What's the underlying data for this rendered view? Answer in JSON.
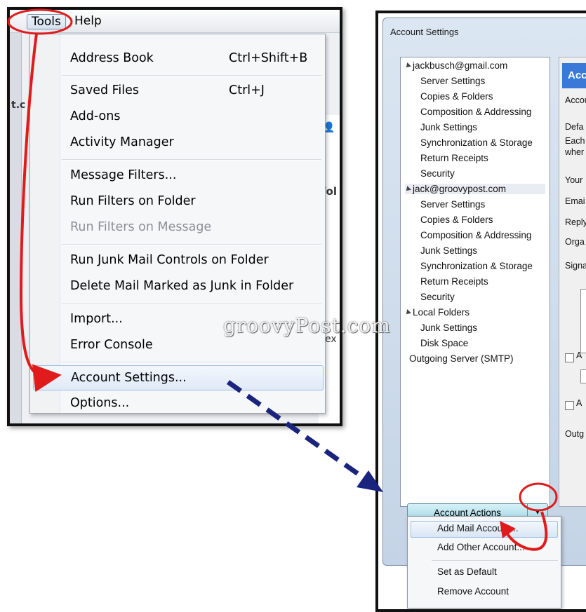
{
  "left": {
    "menubar": {
      "tools": "Tools",
      "help": "Help"
    },
    "background": {
      "folder_fragment": "fol",
      "ex_fragment": "ex",
      "c_fragment": "t.c"
    },
    "menu": [
      {
        "label": "Address Book",
        "shortcut": "Ctrl+Shift+B"
      },
      {
        "label": "Saved Files",
        "shortcut": "Ctrl+J"
      },
      {
        "label": "Add-ons"
      },
      {
        "label": "Activity Manager"
      },
      {
        "label": "Message Filters..."
      },
      {
        "label": "Run Filters on Folder"
      },
      {
        "label": "Run Filters on Message",
        "disabled": true
      },
      {
        "label": "Run Junk Mail Controls on Folder"
      },
      {
        "label": "Delete Mail Marked as Junk in Folder"
      },
      {
        "label": "Import..."
      },
      {
        "label": "Error Console"
      },
      {
        "label": "Account Settings...",
        "highlighted": true
      },
      {
        "label": "Options..."
      }
    ]
  },
  "right": {
    "window_title": "Account Settings",
    "tree": {
      "accounts": [
        {
          "name": "jackbusch@gmail.com",
          "children": [
            "Server Settings",
            "Copies & Folders",
            "Composition & Addressing",
            "Junk Settings",
            "Synchronization & Storage",
            "Return Receipts",
            "Security"
          ]
        },
        {
          "name": "jack@groovypost.com",
          "selected": true,
          "children": [
            "Server Settings",
            "Copies & Folders",
            "Composition & Addressing",
            "Junk Settings",
            "Synchronization & Storage",
            "Return Receipts",
            "Security"
          ]
        },
        {
          "name": "Local Folders",
          "children": [
            "Junk Settings",
            "Disk Space"
          ]
        }
      ],
      "outgoing": "Outgoing Server (SMTP)"
    },
    "content": {
      "header": "Acc",
      "fields": [
        "Accou",
        "Defa",
        "Each",
        "wher",
        "Your",
        "Emai",
        "Reply",
        "Orga",
        "Signa",
        "A",
        "A",
        "Outg"
      ]
    },
    "account_actions": {
      "label": "Account Actions",
      "arrow": "▾"
    },
    "actions_menu": [
      "Add Mail Account...",
      "Add Other Account...",
      "Set as Default",
      "Remove Account"
    ]
  },
  "watermark": "groovyPost.com",
  "colors": {
    "annotation_red": "#e01b1b",
    "arrow_navy": "#1a237e",
    "highlight": "#dfe9f6"
  }
}
